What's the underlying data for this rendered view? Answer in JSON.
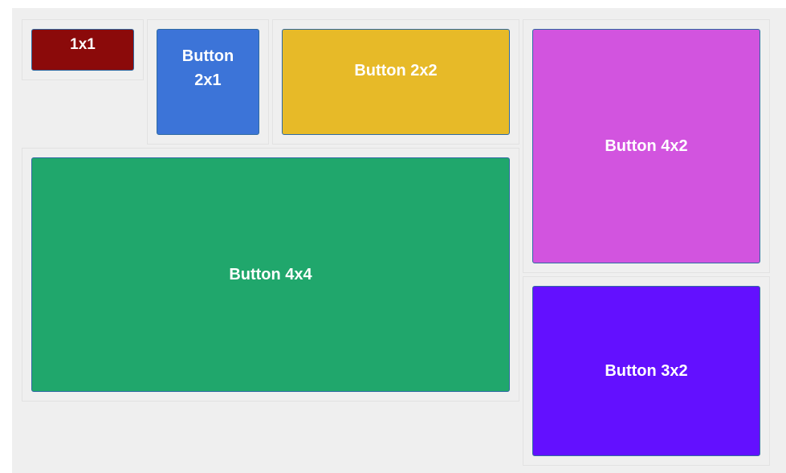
{
  "tiles": [
    {
      "id": "1x1",
      "label": "1x1",
      "color": "#8b0a0a"
    },
    {
      "id": "2x1",
      "label": "Button\n2x1",
      "color": "#3c74d8"
    },
    {
      "id": "2x2",
      "label": "Button 2x2",
      "color": "#e7ba28"
    },
    {
      "id": "4x2",
      "label": "Button 4x2",
      "color": "#d254df"
    },
    {
      "id": "4x4",
      "label": "Button 4x4",
      "color": "#20a76c"
    },
    {
      "id": "3x2",
      "label": "Button 3x2",
      "color": "#6310ff"
    }
  ]
}
